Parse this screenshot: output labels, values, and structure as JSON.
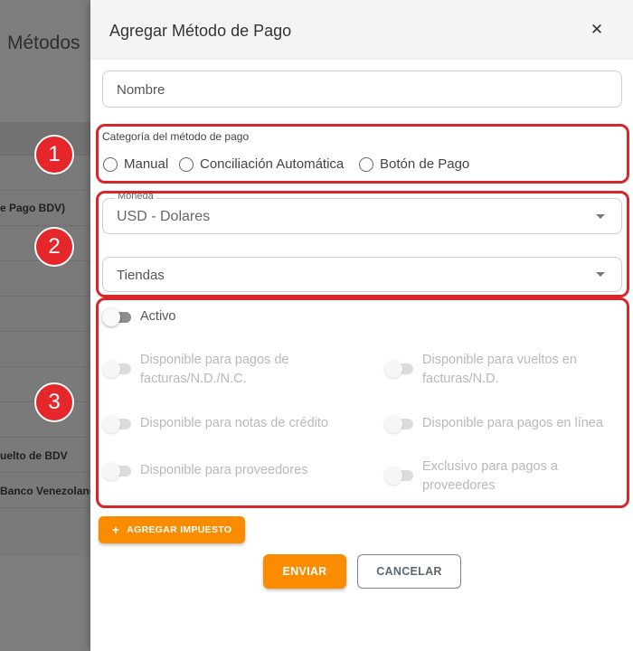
{
  "background": {
    "title": "Métodos",
    "rows": [
      {
        "text": "e Pago BDV)"
      },
      {
        "text": "uelto de BDV"
      },
      {
        "text": "Banco Venezolano"
      }
    ]
  },
  "modal": {
    "title": "Agregar Método de Pago",
    "close_icon": "close-icon",
    "name_placeholder": "Nombre",
    "category": {
      "label": "Categoría del método de pago",
      "options": [
        "Manual",
        "Conciliación Automática",
        "Botón de Pago"
      ]
    },
    "currency": {
      "label": "Moneda",
      "value": "USD - Dolares"
    },
    "stores": {
      "placeholder": "Tiendas"
    },
    "toggles": {
      "active": "Activo",
      "invoice_payments": "Disponible para pagos de facturas/N.D./N.C.",
      "invoice_change": "Disponible para vueltos en facturas/N.D.",
      "credit_notes": "Disponible para notas de crédito",
      "online_payments": "Disponible para pagos en línea",
      "suppliers": "Disponible para proveedores",
      "supplier_exclusive": "Exclusivo para pagos a proveedores"
    },
    "add_tax_button": "AGREGAR IMPUESTO",
    "send_button": "ENVIAR",
    "cancel_button": "CANCELAR"
  },
  "annotations": {
    "badges": [
      "1",
      "2",
      "3"
    ],
    "color": "#d9262b"
  },
  "colors": {
    "accent": "#fb8c00",
    "overlay": "#7e7e7e"
  }
}
